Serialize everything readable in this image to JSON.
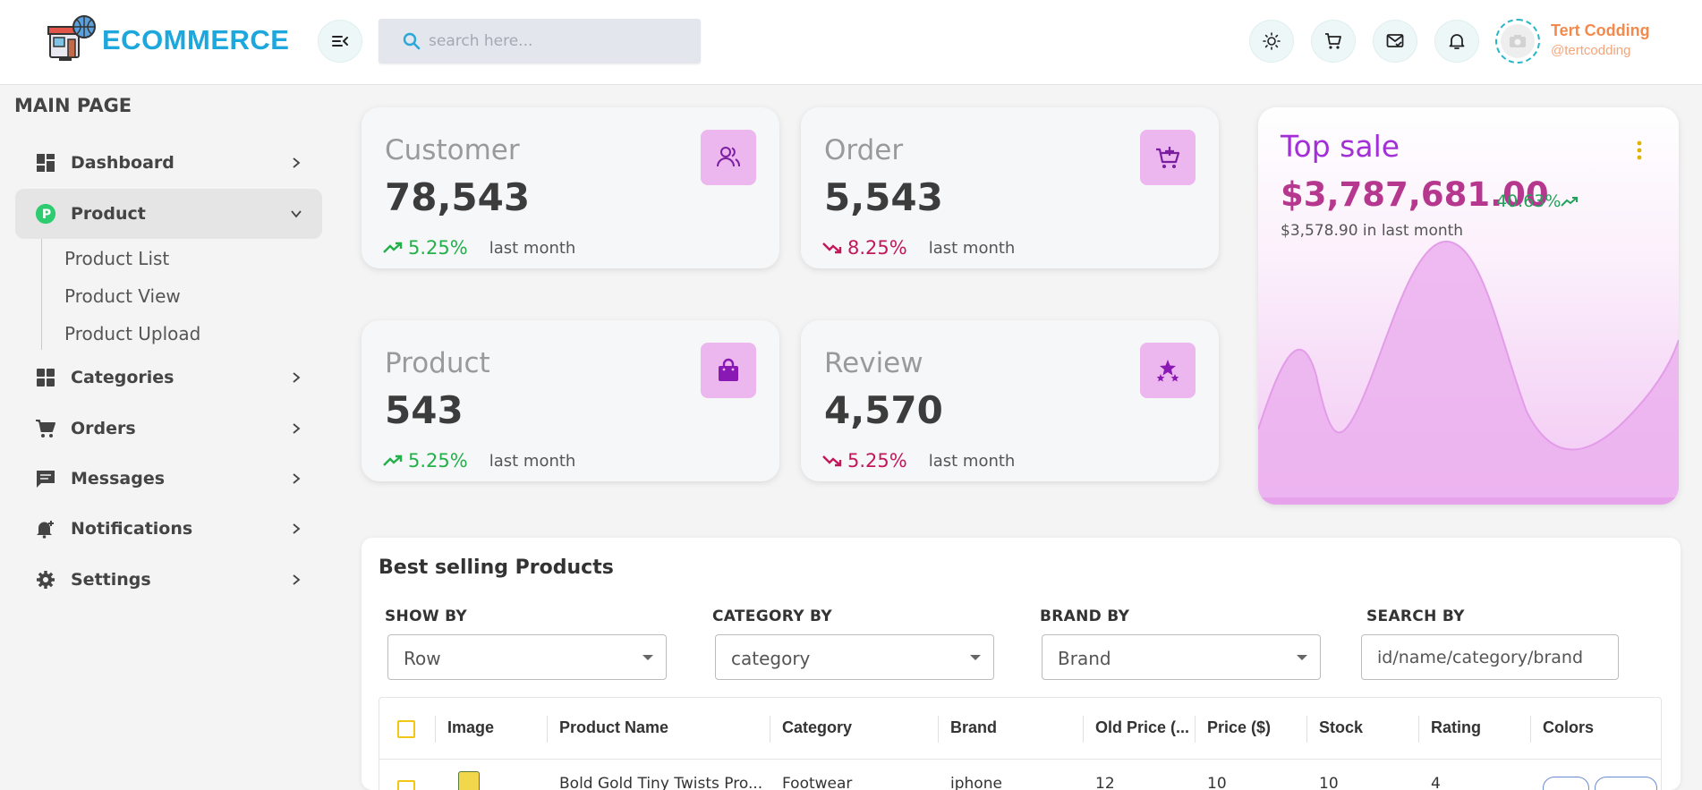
{
  "header": {
    "logo_text": "ECOMMERCE",
    "search_placeholder": "search here...",
    "user_name": "Tert Codding",
    "user_handle": "@tertcodding",
    "icons": [
      "menu-collapse-icon",
      "search-icon",
      "sun-icon",
      "cart-icon",
      "mail-check-icon",
      "bell-icon",
      "camera-icon"
    ]
  },
  "sidebar": {
    "title": "MAIN PAGE",
    "items": [
      {
        "label": "Dashboard",
        "icon": "dashboard-icon"
      },
      {
        "label": "Product",
        "icon": "product-badge-icon",
        "badge": "P"
      },
      {
        "label": "Categories",
        "icon": "categories-icon"
      },
      {
        "label": "Orders",
        "icon": "cart-icon"
      },
      {
        "label": "Messages",
        "icon": "message-icon"
      },
      {
        "label": "Notifications",
        "icon": "bell-plus-icon"
      },
      {
        "label": "Settings",
        "icon": "gear-icon"
      }
    ],
    "product_sub": [
      "Product List",
      "Product View",
      "Product Upload"
    ]
  },
  "cards": [
    {
      "title": "Customer",
      "value": "78,543",
      "trend": "5.25%",
      "direction": "up",
      "note": "last month",
      "icon": "users-icon"
    },
    {
      "title": "Order",
      "value": "5,543",
      "trend": "8.25%",
      "direction": "down",
      "note": "last month",
      "icon": "cart-plus-icon"
    },
    {
      "title": "Product",
      "value": "543",
      "trend": "5.25%",
      "direction": "up",
      "note": "last month",
      "icon": "shopping-bag-icon"
    },
    {
      "title": "Review",
      "value": "4,570",
      "trend": "5.25%",
      "direction": "down",
      "note": "last month",
      "icon": "stars-icon"
    }
  ],
  "top_sale": {
    "title": "Top sale",
    "value": "$3,787,681.00",
    "pct": "40.63%",
    "sub": "$3,578.90 in last month"
  },
  "best_selling": {
    "title": "Best selling Products",
    "filters": [
      {
        "label": "SHOW BY",
        "value": "Row"
      },
      {
        "label": "CATEGORY BY",
        "value": "category"
      },
      {
        "label": "BRAND BY",
        "value": "Brand"
      },
      {
        "label": "SEARCH BY",
        "placeholder": "id/name/category/brand"
      }
    ],
    "columns": [
      "Image",
      "Product Name",
      "Category",
      "Brand",
      "Old Price (...",
      "Price ($)",
      "Stock",
      "Rating",
      "Colors"
    ],
    "rows": [
      {
        "name": "Bold Gold Tiny Twists Pro...",
        "category": "Footwear",
        "brand": "iphone",
        "old_price": "12",
        "price": "10",
        "stock": "10",
        "rating": "4"
      }
    ]
  },
  "colors": {
    "brand": "#1ea7dc",
    "up": "#23b04a",
    "down": "#c2185b",
    "accent_purple": "#a230d6",
    "icon_tile": "#ecb6ee"
  }
}
